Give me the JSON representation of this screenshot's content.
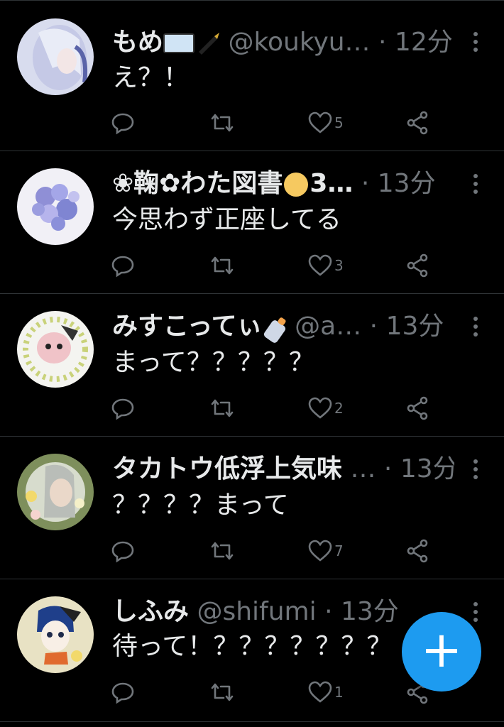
{
  "tweets": [
    {
      "name": "もめ",
      "name_suffix_icons": [
        "book-emoji",
        "pen-emoji"
      ],
      "handle": "@koukyu…",
      "dot": "·",
      "time": "12分",
      "text": "え？！",
      "likes": "5"
    },
    {
      "name": "❀鞠✿わた図書",
      "name_after": "3…",
      "dot": "·",
      "time": "13分",
      "text": "今思わず正座してる",
      "likes": "3"
    },
    {
      "name": "みすこってぃ",
      "handle": "@a…",
      "dot": "·",
      "time": "13分",
      "text": "まって？？？？？",
      "likes": "2"
    },
    {
      "name": "タカトウ低浮上気味",
      "handle": "…",
      "dot": "·",
      "time": "13分",
      "text": "？？？？まって",
      "likes": "7"
    },
    {
      "name": "しふみ",
      "handle": "@shifumi",
      "dot": "·",
      "time": "13分",
      "text": "待って！？？？？？？？",
      "likes": "1"
    }
  ],
  "fab": {
    "label": "+"
  },
  "colors": {
    "background": "#000000",
    "text": "#e7e9ea",
    "muted": "#71767b",
    "accent": "#1d9bf0",
    "divider": "#2f3336"
  }
}
